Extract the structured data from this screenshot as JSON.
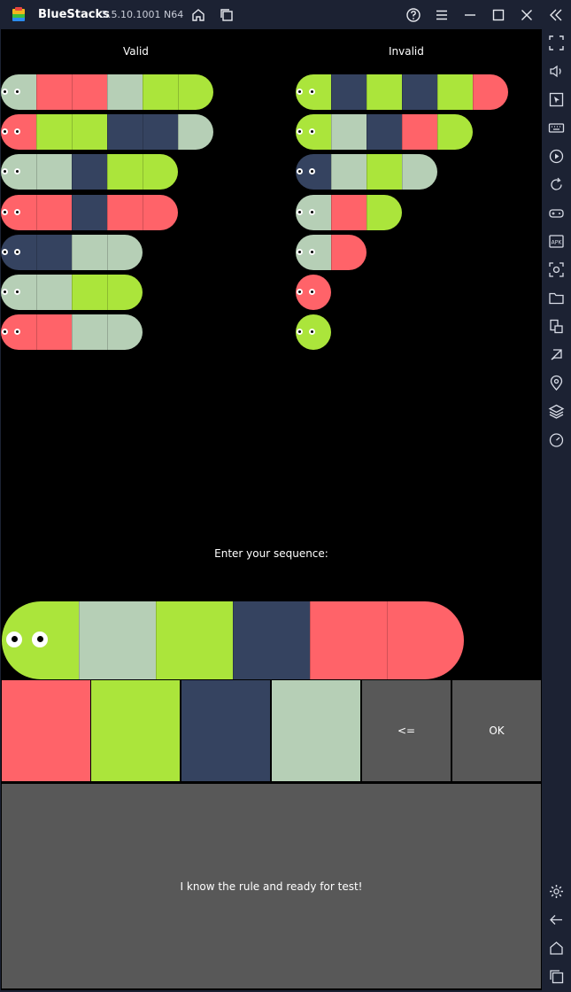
{
  "window": {
    "app_name": "BlueStacks",
    "version": "5.5.10.1001 N64",
    "titlebar_icons": [
      "home-icon",
      "multi-instance-icon",
      "help-icon",
      "menu-icon",
      "minimize-icon",
      "maximize-icon",
      "close-icon",
      "collapse-sidebar-icon"
    ]
  },
  "sidebar": {
    "icons": [
      "fullscreen-icon",
      "volume-icon",
      "pointer-icon",
      "keyboard-icon",
      "record-icon",
      "rotate-icon",
      "gamepad-icon",
      "apk-icon",
      "screenshot-icon",
      "folder-icon",
      "multi-window-icon",
      "eco-mode-icon",
      "location-icon",
      "layers-icon",
      "performance-icon",
      "settings-icon",
      "back-icon",
      "home-icon",
      "recent-apps-icon"
    ]
  },
  "colors": {
    "red": "#ff6369",
    "green": "#abe53b",
    "navy": "#354360",
    "sage": "#b6cfb6",
    "gray_button": "#585858"
  },
  "game": {
    "valid_label": "Valid",
    "invalid_label": "Invalid",
    "valid_sequences": [
      [
        "sage",
        "red",
        "red",
        "sage",
        "green",
        "green"
      ],
      [
        "red",
        "green",
        "green",
        "navy",
        "navy",
        "sage"
      ],
      [
        "sage",
        "sage",
        "navy",
        "green",
        "green"
      ],
      [
        "red",
        "red",
        "navy",
        "red",
        "red"
      ],
      [
        "navy",
        "navy",
        "sage",
        "sage"
      ],
      [
        "sage",
        "sage",
        "green",
        "green"
      ],
      [
        "red",
        "red",
        "sage",
        "sage"
      ]
    ],
    "invalid_sequences": [
      [
        "green",
        "navy",
        "green",
        "navy",
        "green",
        "red"
      ],
      [
        "green",
        "sage",
        "navy",
        "red",
        "green"
      ],
      [
        "navy",
        "sage",
        "green",
        "sage"
      ],
      [
        "sage",
        "red",
        "green"
      ],
      [
        "sage",
        "red"
      ],
      [
        "red"
      ],
      [
        "green"
      ]
    ],
    "prompt": "Enter your sequence:",
    "input_sequence": [
      "green",
      "sage",
      "green",
      "navy",
      "red",
      "red"
    ],
    "palette": [
      {
        "name": "red-color-button",
        "color": "red"
      },
      {
        "name": "green-color-button",
        "color": "green"
      },
      {
        "name": "navy-color-button",
        "color": "navy"
      },
      {
        "name": "sage-color-button",
        "color": "sage"
      }
    ],
    "backspace_label": "<=",
    "ok_label": "OK",
    "ready_label": "I know the rule and ready for test!"
  }
}
